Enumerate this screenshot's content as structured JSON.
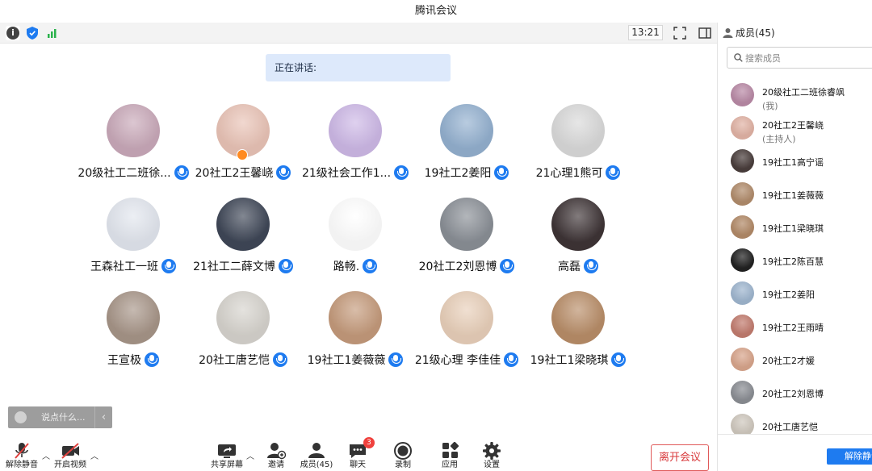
{
  "window": {
    "title": "腾讯会议"
  },
  "topbar": {
    "time": "13:21",
    "info_icon": "info-icon",
    "shield_icon": "shield-icon",
    "signal_icon": "signal-icon"
  },
  "stage": {
    "speaking_label": "正在讲话:",
    "participants": [
      {
        "name": "20级社工二班徐...",
        "avatar_color": "#c9a9b9"
      },
      {
        "name": "20社工2王馨峣",
        "avatar_color": "#e9c3b6",
        "host": true
      },
      {
        "name": "21级社会工作1...",
        "avatar_color": "#cdb8e6"
      },
      {
        "name": "19社工2姜阳",
        "avatar_color": "#93b0cf"
      },
      {
        "name": "21心理1熊可",
        "avatar_color": "#d9d9d9"
      },
      {
        "name": "王森社工一班",
        "avatar_color": "#e2e6ee"
      },
      {
        "name": "21社工二薛文博",
        "avatar_color": "#3f4757"
      },
      {
        "name": "路畅.",
        "avatar_color": "#ffffff"
      },
      {
        "name": "20社工2刘恩博",
        "avatar_color": "#8a8f96"
      },
      {
        "name": "高磊",
        "avatar_color": "#3e3436"
      },
      {
        "name": "王宣极",
        "avatar_color": "#a79588"
      },
      {
        "name": "20社工唐艺恺",
        "avatar_color": "#d6d3cd"
      },
      {
        "name": "19社工1姜薇薇",
        "avatar_color": "#c49a7b"
      },
      {
        "name": "21级心理 李佳佳",
        "avatar_color": "#e8cfb9"
      },
      {
        "name": "19社工1梁晓琪",
        "avatar_color": "#b88d68"
      }
    ]
  },
  "quick_chat": {
    "placeholder": "说点什么...",
    "chevron": "‹"
  },
  "toolbar": {
    "unmute_label": "解除静音",
    "video_label": "开启视频",
    "share_label": "共享屏幕",
    "invite_label": "邀请",
    "members_label": "成员(45)",
    "chat_label": "聊天",
    "chat_badge": "3",
    "record_label": "录制",
    "apps_label": "应用",
    "settings_label": "设置",
    "leave_label": "离开会议"
  },
  "members": {
    "title": "成员(45)",
    "search_placeholder": "搜索成员",
    "unmute_all_label": "解除静音",
    "list": [
      {
        "name": "20级社工二班徐睿飒",
        "role": "(我)",
        "avatar_color": "#b98aa6"
      },
      {
        "name": "20社工2王馨峣",
        "role": "(主持人)",
        "avatar_color": "#e1b3a5"
      },
      {
        "name": "19社工1高宁谣",
        "role": "",
        "avatar_color": "#4a3e3c"
      },
      {
        "name": "19社工1姜薇薇",
        "role": "",
        "avatar_color": "#b18c6c"
      },
      {
        "name": "19社工1梁晓琪",
        "role": "",
        "avatar_color": "#b28a68"
      },
      {
        "name": "19社工2陈百慧",
        "role": "",
        "avatar_color": "#222222"
      },
      {
        "name": "19社工2姜阳",
        "role": "",
        "avatar_color": "#9fb6cf"
      },
      {
        "name": "19社工2王雨晴",
        "role": "",
        "avatar_color": "#c27c6f"
      },
      {
        "name": "20社工2才媛",
        "role": "",
        "avatar_color": "#d8a58c"
      },
      {
        "name": "20社工2刘恩博",
        "role": "",
        "avatar_color": "#8b8e94"
      },
      {
        "name": "20社工唐艺恺",
        "role": "",
        "avatar_color": "#cfc8be"
      }
    ]
  }
}
